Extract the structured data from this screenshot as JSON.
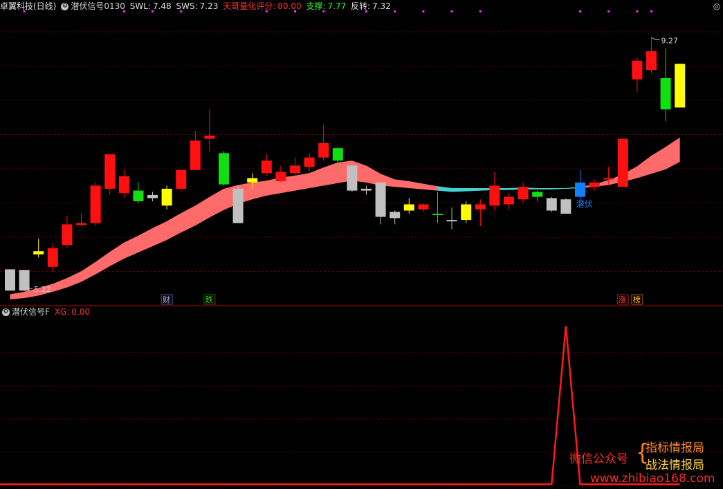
{
  "header_top": {
    "stock": "卓翼科技(日线)",
    "indicator": "潜伏信号0130",
    "swl_label": "SWL:",
    "swl_value": "7.48",
    "sws_label": "SWS:",
    "sws_value": "7.23",
    "score_label": "天哥量化评分:",
    "score_value": "80.00",
    "support_label": "支撑:",
    "support_value": "7.77",
    "reversal_label": "反转:",
    "reversal_value": "7.32"
  },
  "header_bottom": {
    "indicator": "潜伏信号F",
    "xg_label": "XG:",
    "xg_value": "0.00"
  },
  "watermark": {
    "left": "微信公众号",
    "right_top": "指标情报局",
    "right_bottom": "战法情报局",
    "url": "www.zhibiao168.com"
  },
  "colors": {
    "bg": "#000000",
    "grid": "#5a0000",
    "divider": "#b00000",
    "up": "#ff1010",
    "down": "#10e010",
    "yellow": "#ffff00",
    "gray": "#c0c0c0",
    "blue": "#1080ff",
    "band": "#ff6a6a",
    "band_cyan": "#40d0d0",
    "signal": "#ff1a1a"
  },
  "chart_data": [
    {
      "type": "candlestick",
      "title": "卓翼科技(日线)",
      "ylim": [
        5.0,
        9.45
      ],
      "candles": [
        {
          "open": 5.56,
          "close": 5.22,
          "high": 5.56,
          "low": 5.22,
          "color": "gray"
        },
        {
          "open": 5.55,
          "close": 5.22,
          "high": 5.55,
          "low": 5.22,
          "color": "gray"
        },
        {
          "open": 5.85,
          "close": 5.8,
          "high": 6.05,
          "low": 5.75,
          "color": "yellow"
        },
        {
          "open": 5.6,
          "close": 5.9,
          "high": 5.98,
          "low": 5.52,
          "color": "red"
        },
        {
          "open": 5.95,
          "close": 6.28,
          "high": 6.42,
          "low": 5.9,
          "color": "red"
        },
        {
          "open": 6.27,
          "close": 6.3,
          "high": 6.45,
          "low": 6.25,
          "color": "red"
        },
        {
          "open": 6.3,
          "close": 6.9,
          "high": 6.95,
          "low": 6.25,
          "color": "red"
        },
        {
          "open": 6.85,
          "close": 7.4,
          "high": 7.4,
          "low": 6.75,
          "color": "red"
        },
        {
          "open": 6.78,
          "close": 7.05,
          "high": 7.15,
          "low": 6.7,
          "color": "red"
        },
        {
          "open": 6.65,
          "close": 6.82,
          "high": 6.95,
          "low": 6.62,
          "color": "green"
        },
        {
          "open": 6.7,
          "close": 6.75,
          "high": 6.8,
          "low": 6.65,
          "color": "gray"
        },
        {
          "open": 6.85,
          "close": 6.58,
          "high": 6.9,
          "low": 6.52,
          "color": "yellow"
        },
        {
          "open": 6.85,
          "close": 7.15,
          "high": 7.15,
          "low": 6.8,
          "color": "red"
        },
        {
          "open": 7.15,
          "close": 7.62,
          "high": 7.78,
          "low": 7.15,
          "color": "red"
        },
        {
          "open": 7.65,
          "close": 7.7,
          "high": 8.12,
          "low": 7.45,
          "color": "red"
        },
        {
          "open": 7.42,
          "close": 6.92,
          "high": 7.45,
          "low": 6.9,
          "color": "green"
        },
        {
          "open": 6.85,
          "close": 6.3,
          "high": 6.9,
          "low": 6.3,
          "color": "gray"
        },
        {
          "open": 6.95,
          "close": 7.02,
          "high": 7.1,
          "low": 6.85,
          "color": "yellow"
        },
        {
          "open": 7.1,
          "close": 7.3,
          "high": 7.4,
          "low": 7.05,
          "color": "red"
        },
        {
          "open": 6.97,
          "close": 7.12,
          "high": 7.22,
          "low": 6.95,
          "color": "red"
        },
        {
          "open": 7.1,
          "close": 7.22,
          "high": 7.35,
          "low": 7.05,
          "color": "red"
        },
        {
          "open": 7.2,
          "close": 7.35,
          "high": 7.42,
          "low": 7.12,
          "color": "red"
        },
        {
          "open": 7.35,
          "close": 7.58,
          "high": 7.88,
          "low": 7.3,
          "color": "red"
        },
        {
          "open": 7.5,
          "close": 7.3,
          "high": 7.52,
          "low": 7.12,
          "color": "green"
        },
        {
          "open": 7.22,
          "close": 6.82,
          "high": 7.25,
          "low": 6.8,
          "color": "gray"
        },
        {
          "open": 6.85,
          "close": 6.82,
          "high": 6.9,
          "low": 6.75,
          "color": "gray"
        },
        {
          "open": 6.95,
          "close": 6.4,
          "high": 6.95,
          "low": 6.28,
          "color": "gray"
        },
        {
          "open": 6.48,
          "close": 6.38,
          "high": 6.5,
          "low": 6.28,
          "color": "gray"
        },
        {
          "open": 6.5,
          "close": 6.6,
          "high": 6.7,
          "low": 6.45,
          "color": "yellow"
        },
        {
          "open": 6.6,
          "close": 6.52,
          "high": 6.62,
          "low": 6.48,
          "color": "red"
        },
        {
          "open": 6.45,
          "close": 6.45,
          "high": 6.8,
          "low": 6.3,
          "color": "green"
        },
        {
          "open": 6.35,
          "close": 6.35,
          "high": 6.55,
          "low": 6.2,
          "color": "gray"
        },
        {
          "open": 6.6,
          "close": 6.35,
          "high": 6.65,
          "low": 6.3,
          "color": "yellow"
        },
        {
          "open": 6.52,
          "close": 6.6,
          "high": 6.68,
          "low": 6.25,
          "color": "red"
        },
        {
          "open": 6.58,
          "close": 6.9,
          "high": 7.12,
          "low": 6.5,
          "color": "red"
        },
        {
          "open": 6.6,
          "close": 6.72,
          "high": 6.78,
          "low": 6.52,
          "color": "red"
        },
        {
          "open": 6.68,
          "close": 6.88,
          "high": 6.95,
          "low": 6.62,
          "color": "red"
        },
        {
          "open": 6.8,
          "close": 6.72,
          "high": 6.82,
          "low": 6.65,
          "color": "green"
        },
        {
          "open": 6.7,
          "close": 6.5,
          "high": 6.72,
          "low": 6.48,
          "color": "gray"
        },
        {
          "open": 6.68,
          "close": 6.45,
          "high": 6.7,
          "low": 6.45,
          "color": "gray"
        },
        {
          "open": 6.72,
          "close": 6.95,
          "high": 7.15,
          "low": 6.65,
          "color": "blue"
        },
        {
          "open": 6.88,
          "close": 6.95,
          "high": 7.0,
          "low": 6.82,
          "color": "red"
        },
        {
          "open": 7.0,
          "close": 7.02,
          "high": 7.2,
          "low": 6.9,
          "color": "red"
        },
        {
          "open": 6.88,
          "close": 7.65,
          "high": 7.65,
          "low": 6.88,
          "color": "red"
        },
        {
          "open": 8.6,
          "close": 8.9,
          "high": 8.95,
          "low": 8.4,
          "color": "red"
        },
        {
          "open": 8.75,
          "close": 9.05,
          "high": 9.27,
          "low": 8.7,
          "color": "red"
        },
        {
          "open": 8.62,
          "close": 8.12,
          "high": 9.1,
          "low": 7.93,
          "color": "green"
        },
        {
          "open": 8.15,
          "close": 8.85,
          "high": 8.85,
          "low": 8.15,
          "color": "yellow"
        }
      ],
      "band_upper": [
        5.16,
        5.2,
        5.26,
        5.33,
        5.42,
        5.53,
        5.68,
        5.84,
        5.99,
        6.1,
        6.22,
        6.33,
        6.46,
        6.58,
        6.72,
        6.85,
        6.91,
        6.95,
        6.98,
        7.03,
        7.06,
        7.1,
        7.19,
        7.27,
        7.3,
        7.22,
        7.09,
        7.0,
        6.97,
        6.93,
        6.89,
        6.86,
        6.86,
        6.86,
        6.86,
        6.86,
        6.87,
        6.86,
        6.86,
        6.86,
        6.88,
        6.92,
        6.99,
        7.08,
        7.21,
        7.38,
        7.52,
        7.67
      ],
      "band_lower": [
        5.08,
        5.1,
        5.14,
        5.2,
        5.27,
        5.36,
        5.48,
        5.61,
        5.73,
        5.83,
        5.93,
        6.03,
        6.15,
        6.26,
        6.39,
        6.51,
        6.61,
        6.68,
        6.74,
        6.78,
        6.82,
        6.86,
        6.9,
        6.94,
        6.98,
        6.95,
        6.9,
        6.88,
        6.86,
        6.84,
        6.82,
        6.8,
        6.81,
        6.82,
        6.83,
        6.83,
        6.84,
        6.84,
        6.84,
        6.85,
        6.86,
        6.88,
        6.91,
        6.96,
        7.02,
        7.09,
        7.16,
        7.28
      ],
      "band_cyan_range": [
        30,
        40
      ],
      "annotations": [
        {
          "text": "9.27",
          "index": 45,
          "value": 9.27
        },
        {
          "text": "5.22",
          "index": 1,
          "value": 5.22
        },
        {
          "text": "潜伏",
          "index": 40,
          "value": 6.76,
          "color": "#1080ff"
        }
      ],
      "markers": [
        {
          "text": "财",
          "index": 11,
          "color": "#7fb8ff",
          "border": "#2a5da0"
        },
        {
          "text": "跌",
          "index": 14,
          "color": "#10e010",
          "border": "#106010"
        },
        {
          "text": "涨",
          "index": 43,
          "color": "#ff3a3a",
          "border": "#802020"
        },
        {
          "text": "榜",
          "index": 44,
          "color": "#ffd43a",
          "border": "#806020"
        }
      ],
      "top_dots_index": [
        1,
        8,
        10,
        12,
        18,
        20,
        22,
        25,
        27,
        29,
        31,
        33,
        40,
        42,
        44,
        45
      ]
    },
    {
      "type": "line",
      "title": "潜伏信号F",
      "series": [
        {
          "name": "XG",
          "values": [
            0,
            0,
            0,
            0,
            0,
            0,
            0,
            0,
            0,
            0,
            0,
            0,
            0,
            0,
            0,
            0,
            0,
            0,
            0,
            0,
            0,
            0,
            0,
            0,
            0,
            0,
            0,
            0,
            0,
            0,
            0,
            0,
            0,
            0,
            0,
            0,
            0,
            0,
            0,
            1,
            0,
            0,
            0,
            0,
            0,
            0,
            0,
            0
          ]
        }
      ],
      "ylim": [
        0,
        1.05
      ]
    }
  ]
}
